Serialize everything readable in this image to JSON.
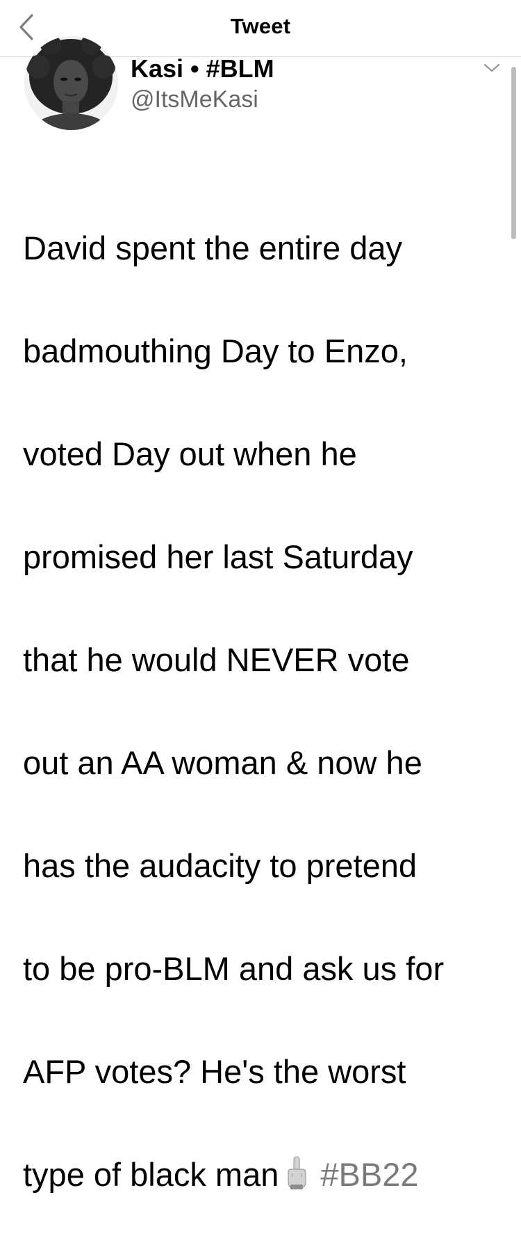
{
  "nav": {
    "title": "Tweet",
    "back_icon": "chevron-left-icon"
  },
  "author": {
    "display_name": "Kasi • #BLM",
    "handle": "@ItsMeKasi",
    "avatar_icon": "avatar-photo"
  },
  "tweet": {
    "lines": [
      "David spent the entire day",
      "badmouthing Day to Enzo,",
      "voted Day out when he",
      "promised her last Saturday",
      "that he would NEVER vote",
      "out an AA woman & now he",
      "has the audacity to pretend",
      "to be pro-BLM and ask us for",
      "AFP votes? He's the worst"
    ],
    "last_line_text": "type of black man",
    "emoji_icon": "middle-finger-emoji-icon",
    "hashtag": "#BB22"
  },
  "colors": {
    "text": "#000000",
    "secondary_text": "#666666",
    "hashtag": "#7a7a7a",
    "divider": "#dcdcdc"
  }
}
